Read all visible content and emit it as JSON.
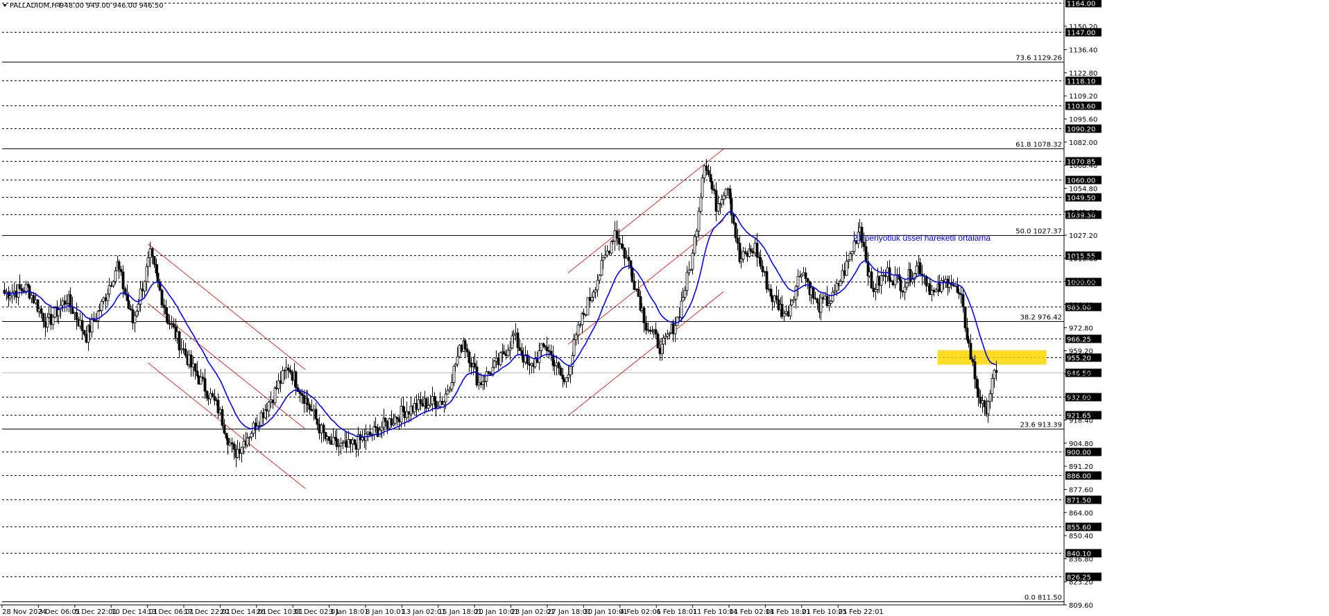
{
  "title": {
    "symbol": "PALLADIUM,H4",
    "ohlc": "948.00 949.00 946.00 946.50"
  },
  "chart_data": {
    "type": "candlestick",
    "symbol": "PALLADIUM",
    "timeframe": "H4",
    "ylim": [
      809.6,
      1164.0
    ],
    "y_ticks": [
      1150.2,
      1136.4,
      1122.8,
      1109.2,
      1095.6,
      1082.0,
      1068.4,
      1054.8,
      1041.0,
      1027.2,
      1013.6,
      1000.0,
      986.4,
      972.8,
      959.2,
      945.6,
      932.0,
      918.4,
      904.8,
      891.2,
      877.6,
      864.0,
      850.4,
      836.8,
      823.2,
      809.6
    ],
    "x_ticks": [
      "28 Nov 2024",
      "3 Dec 06:01",
      "5 Dec 22:01",
      "10 Dec 14:01",
      "13 Dec 06:01",
      "17 Dec 22:01",
      "20 Dec 14:01",
      "26 Dec 10:01",
      "31 Dec 02:01",
      "3 Jan 18:01",
      "8 Jan 10:01",
      "13 Jan 02:01",
      "15 Jan 18:01",
      "20 Jan 10:01",
      "23 Jan 02:01",
      "27 Jan 18:01",
      "30 Jan 10:01",
      "4 Feb 02:01",
      "6 Feb 18:01",
      "11 Feb 10:01",
      "14 Feb 02:01",
      "18 Feb 18:01",
      "21 Feb 10:01",
      "25 Feb 22:01"
    ],
    "horizontal_levels": [
      1164.0,
      1147.0,
      1118.1,
      1103.6,
      1090.2,
      1070.85,
      1060.0,
      1049.5,
      1039.3,
      1015.55,
      1000.0,
      985.0,
      966.25,
      955.2,
      932.0,
      921.65,
      900.0,
      886.0,
      871.5,
      855.6,
      840.1,
      826.25
    ],
    "fibonacci": [
      {
        "level": "73.6",
        "price": 1129.26
      },
      {
        "level": "61.8",
        "price": 1078.32
      },
      {
        "level": "50.0",
        "price": 1027.37
      },
      {
        "level": "38.2",
        "price": 976.42
      },
      {
        "level": "23.6",
        "price": 913.39
      },
      {
        "level": "0.0",
        "price": 811.5
      }
    ],
    "current_price": 946.5,
    "key_points": [
      {
        "i": 0,
        "p": 993
      },
      {
        "i": 12,
        "p": 996
      },
      {
        "i": 22,
        "p": 975
      },
      {
        "i": 32,
        "p": 990
      },
      {
        "i": 42,
        "p": 968
      },
      {
        "i": 50,
        "p": 986
      },
      {
        "i": 58,
        "p": 1010
      },
      {
        "i": 66,
        "p": 976
      },
      {
        "i": 75,
        "p": 1015
      },
      {
        "i": 84,
        "p": 978
      },
      {
        "i": 96,
        "p": 950
      },
      {
        "i": 110,
        "p": 925
      },
      {
        "i": 118,
        "p": 898
      },
      {
        "i": 128,
        "p": 914
      },
      {
        "i": 138,
        "p": 933
      },
      {
        "i": 146,
        "p": 950
      },
      {
        "i": 156,
        "p": 928
      },
      {
        "i": 166,
        "p": 905
      },
      {
        "i": 176,
        "p": 902
      },
      {
        "i": 186,
        "p": 908
      },
      {
        "i": 196,
        "p": 916
      },
      {
        "i": 206,
        "p": 924
      },
      {
        "i": 216,
        "p": 928
      },
      {
        "i": 226,
        "p": 930
      },
      {
        "i": 236,
        "p": 966
      },
      {
        "i": 244,
        "p": 940
      },
      {
        "i": 254,
        "p": 952
      },
      {
        "i": 262,
        "p": 968
      },
      {
        "i": 270,
        "p": 948
      },
      {
        "i": 278,
        "p": 963
      },
      {
        "i": 288,
        "p": 940
      },
      {
        "i": 296,
        "p": 975
      },
      {
        "i": 306,
        "p": 1005
      },
      {
        "i": 314,
        "p": 1030
      },
      {
        "i": 322,
        "p": 1008
      },
      {
        "i": 330,
        "p": 975
      },
      {
        "i": 338,
        "p": 960
      },
      {
        "i": 346,
        "p": 978
      },
      {
        "i": 354,
        "p": 1015
      },
      {
        "i": 360,
        "p": 1072
      },
      {
        "i": 366,
        "p": 1045
      },
      {
        "i": 372,
        "p": 1058
      },
      {
        "i": 378,
        "p": 1012
      },
      {
        "i": 386,
        "p": 1020
      },
      {
        "i": 394,
        "p": 992
      },
      {
        "i": 402,
        "p": 980
      },
      {
        "i": 410,
        "p": 1008
      },
      {
        "i": 418,
        "p": 985
      },
      {
        "i": 426,
        "p": 990
      },
      {
        "i": 434,
        "p": 1012
      },
      {
        "i": 440,
        "p": 1033
      },
      {
        "i": 446,
        "p": 995
      },
      {
        "i": 454,
        "p": 1005
      },
      {
        "i": 462,
        "p": 998
      },
      {
        "i": 470,
        "p": 1010
      },
      {
        "i": 478,
        "p": 992
      },
      {
        "i": 486,
        "p": 1002
      },
      {
        "i": 492,
        "p": 988
      },
      {
        "i": 496,
        "p": 962
      },
      {
        "i": 500,
        "p": 938
      },
      {
        "i": 504,
        "p": 922
      },
      {
        "i": 508,
        "p": 940
      },
      {
        "i": 510,
        "p": 946.5
      }
    ],
    "ema": {
      "period": 21,
      "type": "exponential"
    },
    "trend_channels": [
      {
        "name": "down-channel",
        "p1": {
          "i": 74,
          "p": 1022
        },
        "p2": {
          "i": 155,
          "p": 948
        },
        "offset": -70
      },
      {
        "name": "up-channel",
        "p1": {
          "i": 290,
          "p": 1005
        },
        "p2": {
          "i": 370,
          "p": 1078
        },
        "offset": -84
      }
    ],
    "highlight_zone": {
      "price_top": 959.5,
      "price_bottom": 951.0,
      "i_start": 480,
      "i_end": 536
    }
  },
  "annotation": {
    "text": "21 periyotluk üssel hareketli ortalama",
    "color": "#0000ff"
  },
  "colors": {
    "background": "#ffffff",
    "candle": "#000000",
    "ema": "#0000ff",
    "channel": "#cc0000",
    "zone": "#ffd700",
    "badge": "#000000"
  }
}
